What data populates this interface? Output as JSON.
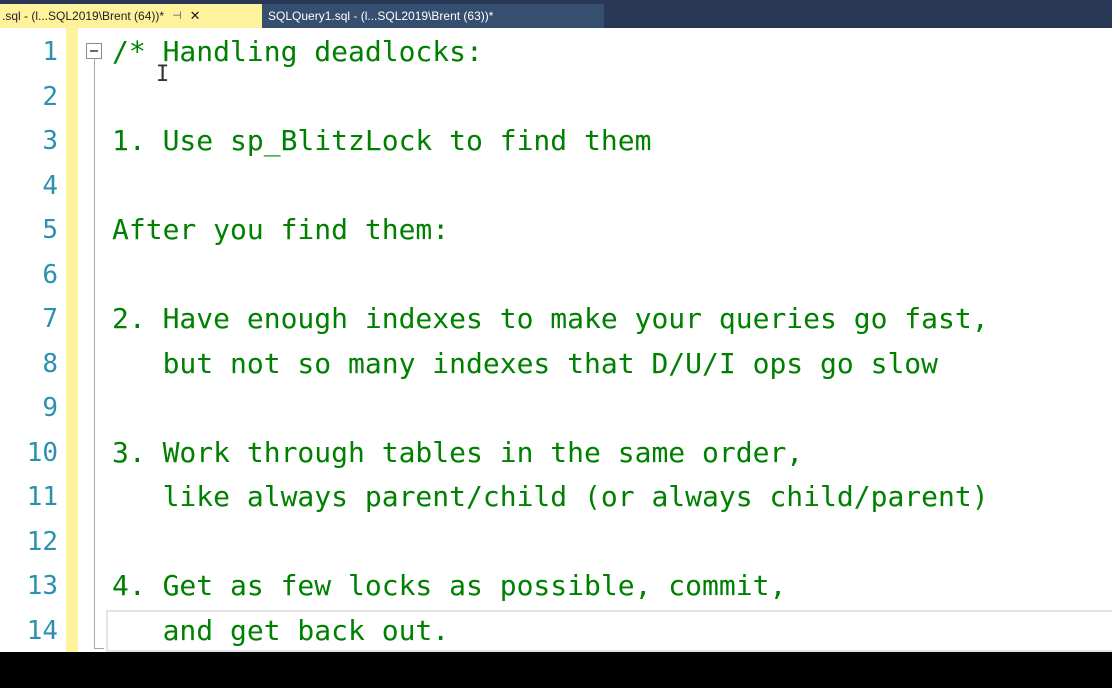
{
  "tabs": [
    {
      "label": ".sql - (l...SQL2019\\Brent (64))*",
      "pin_icon": "pin-icon",
      "close_icon": "close-icon"
    },
    {
      "label": "SQLQuery1.sql - (l...SQL2019\\Brent (63))*"
    }
  ],
  "editor": {
    "lines": [
      {
        "number": "1",
        "text": "/* Handling deadlocks:"
      },
      {
        "number": "2",
        "text": ""
      },
      {
        "number": "3",
        "text": "1. Use sp_BlitzLock to find them"
      },
      {
        "number": "4",
        "text": ""
      },
      {
        "number": "5",
        "text": "After you find them:"
      },
      {
        "number": "6",
        "text": ""
      },
      {
        "number": "7",
        "text": "2. Have enough indexes to make your queries go fast,"
      },
      {
        "number": "8",
        "text": "   but not so many indexes that D/U/I ops go slow"
      },
      {
        "number": "9",
        "text": ""
      },
      {
        "number": "10",
        "text": "3. Work through tables in the same order,"
      },
      {
        "number": "11",
        "text": "   like always parent/child (or always child/parent)"
      },
      {
        "number": "12",
        "text": ""
      },
      {
        "number": "13",
        "text": "4. Get as few locks as possible, commit,"
      },
      {
        "number": "14",
        "text": "   and get back out."
      }
    ],
    "comment_color": "#008000",
    "line_number_color": "#2b91af",
    "change_bar_color": "#fff29d",
    "cursor_glyph": "I"
  }
}
